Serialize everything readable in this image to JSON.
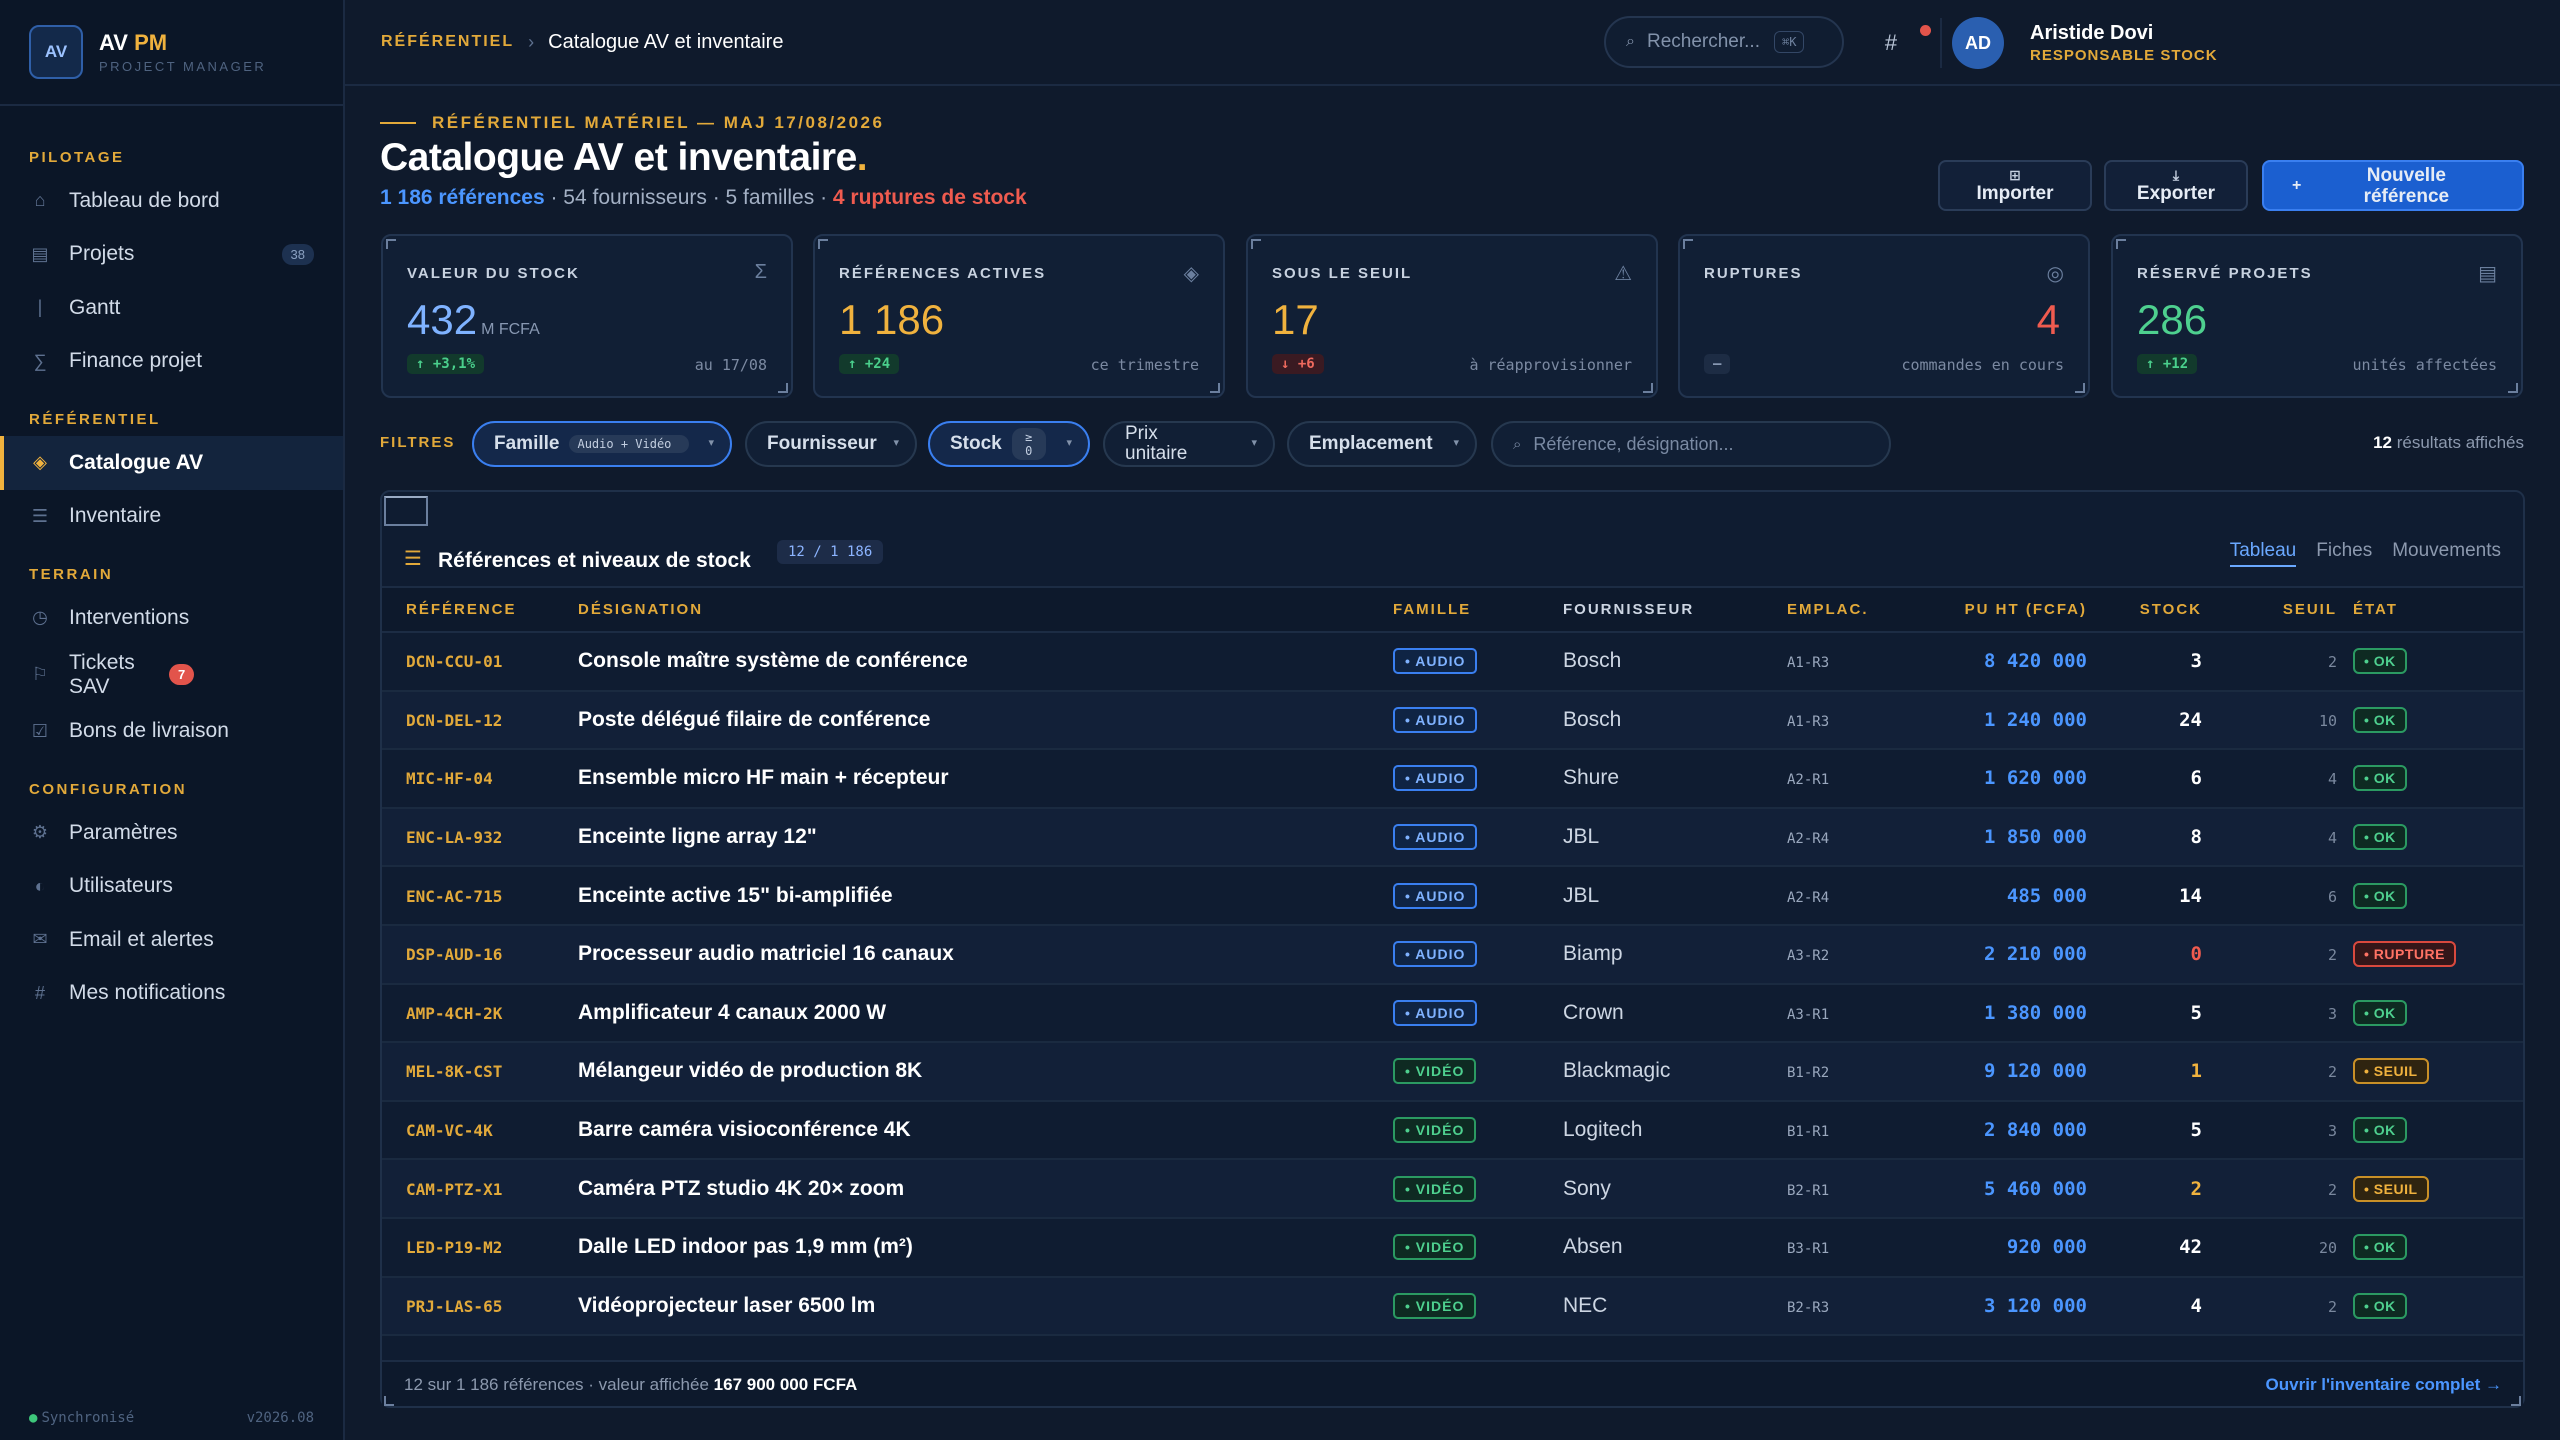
{
  "brand": {
    "logo": "AV",
    "name": "AV",
    "name_accent": "PM",
    "subtitle": "PROJECT MANAGER"
  },
  "sidebar": {
    "sections": [
      {
        "title": "PILOTAGE",
        "items": [
          {
            "label": "Tableau de bord",
            "icon": "home-icon"
          },
          {
            "label": "Projets",
            "icon": "grid-icon",
            "badge": "38"
          },
          {
            "label": "Gantt",
            "icon": "gantt-icon"
          },
          {
            "label": "Finance projet",
            "icon": "sigma-icon"
          }
        ]
      },
      {
        "title": "RÉFÉRENTIEL",
        "items": [
          {
            "label": "Catalogue AV",
            "icon": "diamond-icon",
            "active": true
          },
          {
            "label": "Inventaire",
            "icon": "list-icon"
          }
        ]
      },
      {
        "title": "TERRAIN",
        "items": [
          {
            "label": "Interventions",
            "icon": "clock-icon"
          },
          {
            "label": "Tickets SAV",
            "icon": "flag-icon",
            "badge": "7"
          },
          {
            "label": "Bons de livraison",
            "icon": "check-icon"
          }
        ]
      },
      {
        "title": "CONFIGURATION",
        "items": [
          {
            "label": "Paramètres",
            "icon": "gear-icon"
          },
          {
            "label": "Utilisateurs",
            "icon": "user-icon"
          },
          {
            "label": "Email et alertes",
            "icon": "mail-icon"
          },
          {
            "label": "Mes notifications",
            "icon": "hash-icon"
          }
        ]
      }
    ],
    "footer": {
      "status": "Synchronisé",
      "version": "v2026.08"
    }
  },
  "topbar": {
    "breadcrumb_root": "RÉFÉRENTIEL",
    "breadcrumb_current": "Catalogue AV et inventaire",
    "search_placeholder": "Rechercher...",
    "search_shortcut": "⌘K",
    "user": {
      "initials": "AD",
      "name": "Aristide Dovi",
      "role": "RESPONSABLE STOCK"
    }
  },
  "header": {
    "eyebrow": "RÉFÉRENTIEL MATÉRIEL — MAJ 17/08/2026",
    "title": "Catalogue AV et inventaire",
    "subtitle": {
      "refs": "1 186 références",
      "suppliers": " · 54 fournisseurs · 5 familles · ",
      "ruptures": "4 ruptures de stock"
    },
    "buttons": {
      "import": "Importer",
      "export": "Exporter",
      "new": "Nouvelle référence"
    }
  },
  "kpis": [
    {
      "label": "VALEUR DU STOCK",
      "icon": "sigma-icon",
      "value": "432",
      "unit": "M FCFA",
      "delta": "↑ +3,1%",
      "delta_type": "up",
      "note": "au 17/08",
      "color": "#7fb2ff"
    },
    {
      "label": "RÉFÉRENCES ACTIVES",
      "icon": "diamond-icon",
      "value": "1 186",
      "unit": "",
      "delta": "↑ +24",
      "delta_type": "up",
      "note": "ce trimestre",
      "color": "#f0b23e"
    },
    {
      "label": "SOUS LE SEUIL",
      "icon": "warning-icon",
      "value": "17",
      "unit": "",
      "delta": "↓ +6",
      "delta_type": "down",
      "note": "à réapprovisionner",
      "color": "#f0b23e"
    },
    {
      "label": "RUPTURES",
      "icon": "target-icon",
      "value": "4",
      "unit": "",
      "delta": "–",
      "delta_type": "neutral",
      "note": "commandes en cours",
      "color": "#ef5b4f"
    },
    {
      "label": "RÉSERVÉ PROJETS",
      "icon": "grid-icon",
      "value": "286",
      "unit": "",
      "delta": "↑ +12",
      "delta_type": "up",
      "note": "unités affectées",
      "color": "#4ed08f"
    }
  ],
  "filters": {
    "label": "FILTRES",
    "famille": {
      "label": "Famille",
      "value": "Audio + Vidéo"
    },
    "fournisseur": {
      "label": "Fournisseur"
    },
    "stock": {
      "label": "Stock",
      "value": "≥ 0"
    },
    "prix": {
      "label": "Prix unitaire"
    },
    "emplacement": {
      "label": "Emplacement"
    },
    "search_placeholder": "Référence, désignation...",
    "results_count": "12",
    "results_text": " résultats affichés"
  },
  "table": {
    "title": "Références et niveaux de stock",
    "count": "12 / 1 186",
    "views": [
      "Tableau",
      "Fiches",
      "Mouvements"
    ],
    "columns": [
      "RÉFÉRENCE",
      "DÉSIGNATION",
      "FAMILLE",
      "FOURNISSEUR",
      "EMPLAC.",
      "PU HT (FCFA)",
      "STOCK",
      "SEUIL",
      "ÉTAT"
    ],
    "rows": [
      {
        "ref": "DCN-CCU-01",
        "des": "Console maître système de conférence",
        "fam": "• AUDIO",
        "four": "Bosch",
        "emp": "A1-R3",
        "pu": "8 420 000",
        "stock": "3",
        "seuil": "2",
        "etat": "• OK"
      },
      {
        "ref": "DCN-DEL-12",
        "des": "Poste délégué filaire de conférence",
        "fam": "• AUDIO",
        "four": "Bosch",
        "emp": "A1-R3",
        "pu": "1 240 000",
        "stock": "24",
        "seuil": "10",
        "etat": "• OK"
      },
      {
        "ref": "MIC-HF-04",
        "des": "Ensemble micro HF main + récepteur",
        "fam": "• AUDIO",
        "four": "Shure",
        "emp": "A2-R1",
        "pu": "1 620 000",
        "stock": "6",
        "seuil": "4",
        "etat": "• OK"
      },
      {
        "ref": "ENC-LA-932",
        "des": "Enceinte ligne array 12\"",
        "fam": "• AUDIO",
        "four": "JBL",
        "emp": "A2-R4",
        "pu": "1 850 000",
        "stock": "8",
        "seuil": "4",
        "etat": "• OK"
      },
      {
        "ref": "ENC-AC-715",
        "des": "Enceinte active 15\" bi-amplifiée",
        "fam": "• AUDIO",
        "four": "JBL",
        "emp": "A2-R4",
        "pu": "485 000",
        "stock": "14",
        "seuil": "6",
        "etat": "• OK"
      },
      {
        "ref": "DSP-AUD-16",
        "des": "Processeur audio matriciel 16 canaux",
        "fam": "• AUDIO",
        "four": "Biamp",
        "emp": "A3-R2",
        "pu": "2 210 000",
        "stock": "0",
        "seuil": "2",
        "etat": "• RUPTURE"
      },
      {
        "ref": "AMP-4CH-2K",
        "des": "Amplificateur 4 canaux 2000 W",
        "fam": "• AUDIO",
        "four": "Crown",
        "emp": "A3-R1",
        "pu": "1 380 000",
        "stock": "5",
        "seuil": "3",
        "etat": "• OK"
      },
      {
        "ref": "MEL-8K-CST",
        "des": "Mélangeur vidéo de production 8K",
        "fam": "• VIDÉO",
        "four": "Blackmagic",
        "emp": "B1-R2",
        "pu": "9 120 000",
        "stock": "1",
        "seuil": "2",
        "etat": "• SEUIL"
      },
      {
        "ref": "CAM-VC-4K",
        "des": "Barre caméra visioconférence 4K",
        "fam": "• VIDÉO",
        "four": "Logitech",
        "emp": "B1-R1",
        "pu": "2 840 000",
        "stock": "5",
        "seuil": "3",
        "etat": "• OK"
      },
      {
        "ref": "CAM-PTZ-X1",
        "des": "Caméra PTZ studio 4K 20× zoom",
        "fam": "• VIDÉO",
        "four": "Sony",
        "emp": "B2-R1",
        "pu": "5 460 000",
        "stock": "2",
        "seuil": "2",
        "etat": "• SEUIL"
      },
      {
        "ref": "LED-P19-M2",
        "des": "Dalle LED indoor pas 1,9 mm (m²)",
        "fam": "• VIDÉO",
        "four": "Absen",
        "emp": "B3-R1",
        "pu": "920 000",
        "stock": "42",
        "seuil": "20",
        "etat": "• OK"
      },
      {
        "ref": "PRJ-LAS-65",
        "des": "Vidéoprojecteur laser 6500 lm",
        "fam": "• VIDÉO",
        "four": "NEC",
        "emp": "B2-R3",
        "pu": "3 120 000",
        "stock": "4",
        "seuil": "2",
        "etat": "• OK"
      }
    ],
    "footer": {
      "left": "12 sur 1 186 références · valeur affichée ",
      "left_bold": "167 900 000 FCFA",
      "right": "Ouvrir l'inventaire complet →"
    }
  }
}
